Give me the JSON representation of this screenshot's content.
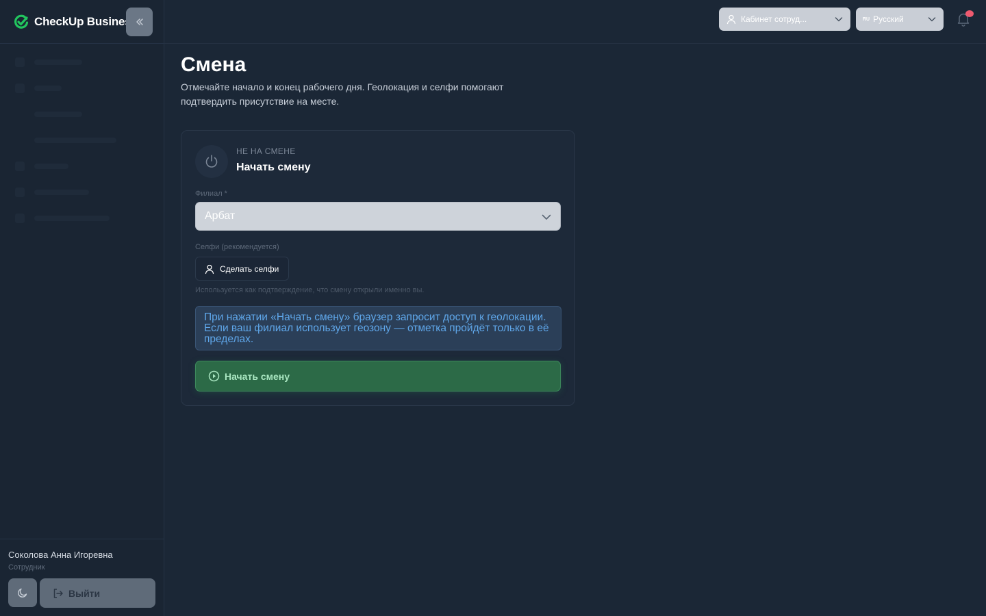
{
  "brand": {
    "name": "CheckUp Business"
  },
  "colors": {
    "accent": "#22c55e",
    "info": "#5fa7ea",
    "danger": "#ef5a6f"
  },
  "sidebar": {
    "user_name": "Соколова Анна Игоревна",
    "user_role": "Сотрудник",
    "logout_label": "Выйти"
  },
  "header": {
    "cabinet_label": "Кабинет сотруд...",
    "lang_code": "RU",
    "lang_label": "Русский"
  },
  "page": {
    "title": "Смена",
    "description": "Отмечайте начало и конец рабочего дня. Геолокация и селфи помогают подтвердить присутствие на месте."
  },
  "shift": {
    "status_label": "НЕ НА СМЕНЕ",
    "status_title": "Начать смену",
    "branch_label": "Филиал *",
    "branch_value": "Арбат",
    "selfie_label": "Селфи (рекомендуется)",
    "selfie_button": "Сделать селфи",
    "selfie_hint": "Используется как подтверждение, что смену открыли именно вы.",
    "info_text": "При нажатии «Начать смену» браузер запросит доступ к геолокации. Если ваш филиал использует геозону — отметка пройдёт только в её пределах.",
    "start_button": "Начать смену"
  }
}
